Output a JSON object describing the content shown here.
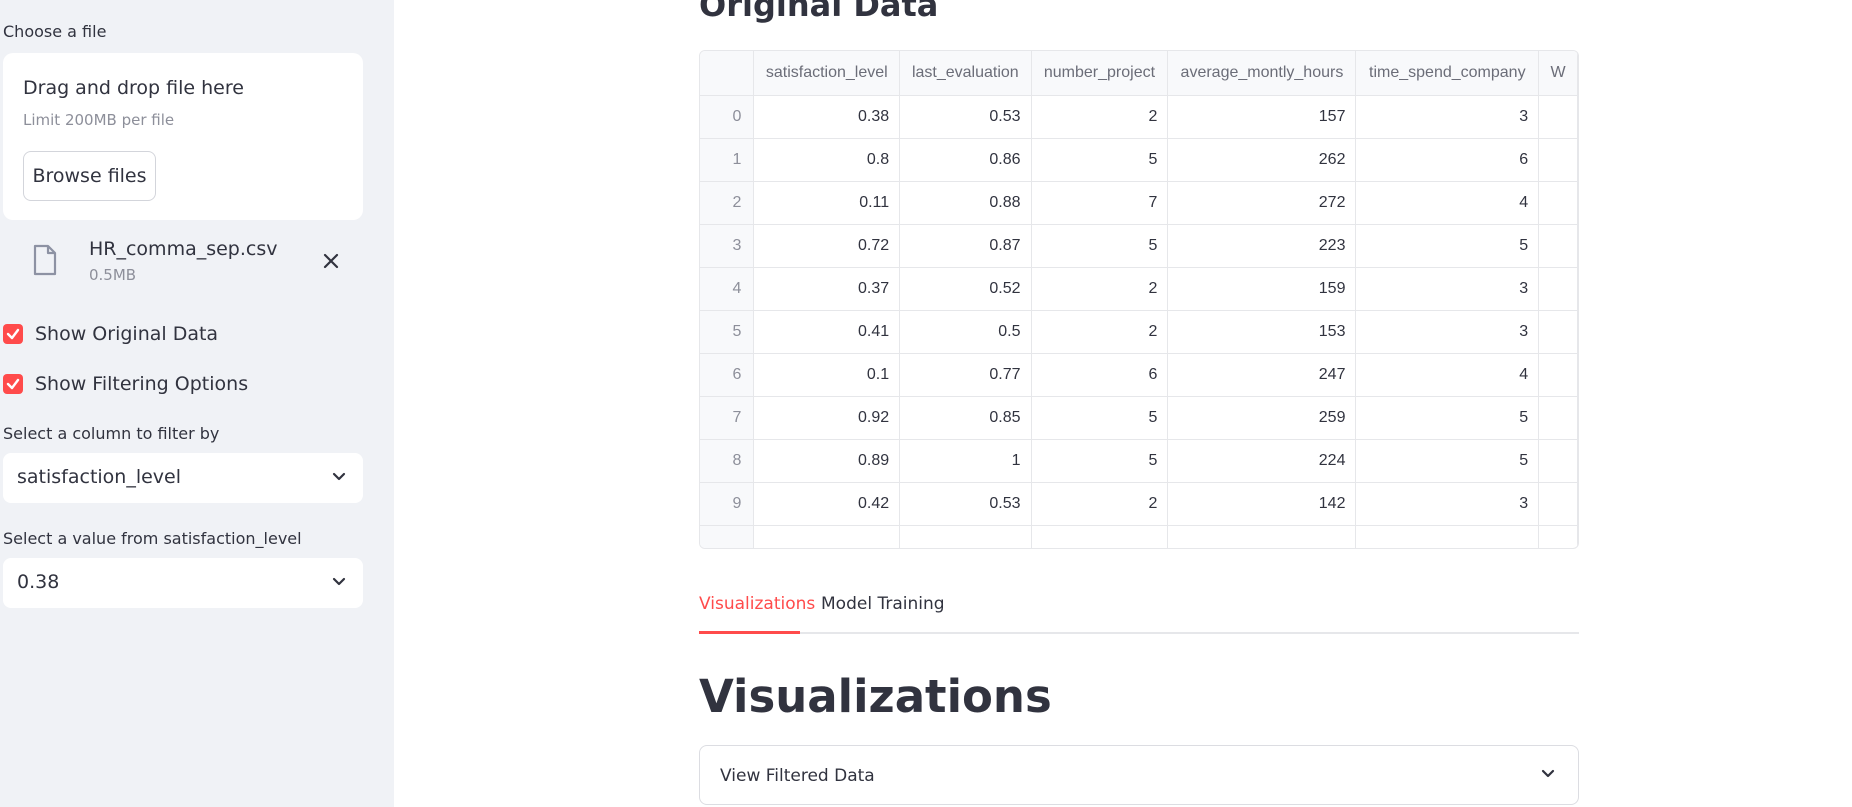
{
  "sidebar": {
    "uploader_label": "Choose a file",
    "drop_title": "Drag and drop file here",
    "limit_text": "Limit 200MB per file",
    "browse_label": "Browse files",
    "file": {
      "name": "HR_comma_sep.csv",
      "size": "0.5MB",
      "icon": "file-icon"
    },
    "checkboxes": [
      {
        "label": "Show Original Data",
        "checked": true
      },
      {
        "label": "Show Filtering Options",
        "checked": true
      }
    ],
    "filter_column_label": "Select a column to filter by",
    "filter_column_value": "satisfaction_level",
    "filter_value_label": "Select a value from satisfaction_level",
    "filter_value": "0.38"
  },
  "main": {
    "title": "Original Data",
    "table": {
      "columns": [
        "satisfaction_level",
        "last_evaluation",
        "number_project",
        "average_montly_hours",
        "time_spend_company",
        "W"
      ],
      "rows": [
        [
          "0",
          "0.38",
          "0.53",
          "2",
          "157",
          "3"
        ],
        [
          "1",
          "0.8",
          "0.86",
          "5",
          "262",
          "6"
        ],
        [
          "2",
          "0.11",
          "0.88",
          "7",
          "272",
          "4"
        ],
        [
          "3",
          "0.72",
          "0.87",
          "5",
          "223",
          "5"
        ],
        [
          "4",
          "0.37",
          "0.52",
          "2",
          "159",
          "3"
        ],
        [
          "5",
          "0.41",
          "0.5",
          "2",
          "153",
          "3"
        ],
        [
          "6",
          "0.1",
          "0.77",
          "6",
          "247",
          "4"
        ],
        [
          "7",
          "0.92",
          "0.85",
          "5",
          "259",
          "5"
        ],
        [
          "8",
          "0.89",
          "1",
          "5",
          "224",
          "5"
        ],
        [
          "9",
          "0.42",
          "0.53",
          "2",
          "142",
          "3"
        ]
      ]
    },
    "tabs": [
      {
        "label": "Visualizations",
        "active": true
      },
      {
        "label": "Model Training",
        "active": false
      }
    ],
    "section_title": "Visualizations",
    "expander_label": "View Filtered Data"
  },
  "colors": {
    "accent": "#ff4b4b",
    "sidebar_bg": "#f0f2f6",
    "text": "#31333f"
  }
}
